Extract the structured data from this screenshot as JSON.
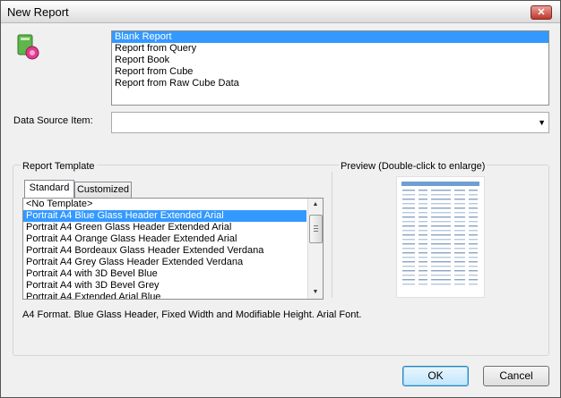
{
  "window": {
    "title": "New Report",
    "close_label": "✕"
  },
  "report_types": {
    "items": [
      {
        "label": "Blank Report",
        "selected": true
      },
      {
        "label": "Report from Query",
        "selected": false
      },
      {
        "label": "Report Book",
        "selected": false
      },
      {
        "label": "Report from Cube",
        "selected": false
      },
      {
        "label": "Report from Raw Cube Data",
        "selected": false
      }
    ]
  },
  "data_source": {
    "label": "Data Source Item:",
    "value": ""
  },
  "report_template": {
    "group_label": "Report Template",
    "tabs": [
      {
        "label": "Standard",
        "active": true
      },
      {
        "label": "Customized",
        "active": false
      }
    ],
    "templates": [
      {
        "label": "<No Template>",
        "selected": false
      },
      {
        "label": "Portrait A4 Blue Glass Header Extended Arial",
        "selected": true
      },
      {
        "label": "Portrait A4 Green Glass Header Extended Arial",
        "selected": false
      },
      {
        "label": "Portrait A4 Orange Glass Header Extended Arial",
        "selected": false
      },
      {
        "label": "Portrait A4 Bordeaux Glass Header Extended Verdana",
        "selected": false
      },
      {
        "label": "Portrait A4 Grey Glass Header Extended Verdana",
        "selected": false
      },
      {
        "label": "Portrait A4 with 3D Bevel Blue",
        "selected": false
      },
      {
        "label": "Portrait A4 with 3D Bevel Grey",
        "selected": false
      },
      {
        "label": "Portrait A4 Extended Arial Blue",
        "selected": false
      }
    ],
    "description": "A4 Format. Blue Glass Header, Fixed Width and Modifiable Height. Arial Font."
  },
  "preview": {
    "label": "Preview (Double-click to enlarge)"
  },
  "buttons": {
    "ok": "OK",
    "cancel": "Cancel"
  },
  "colors": {
    "selection": "#3399ff",
    "accent_blue": "#3c7fb1"
  }
}
